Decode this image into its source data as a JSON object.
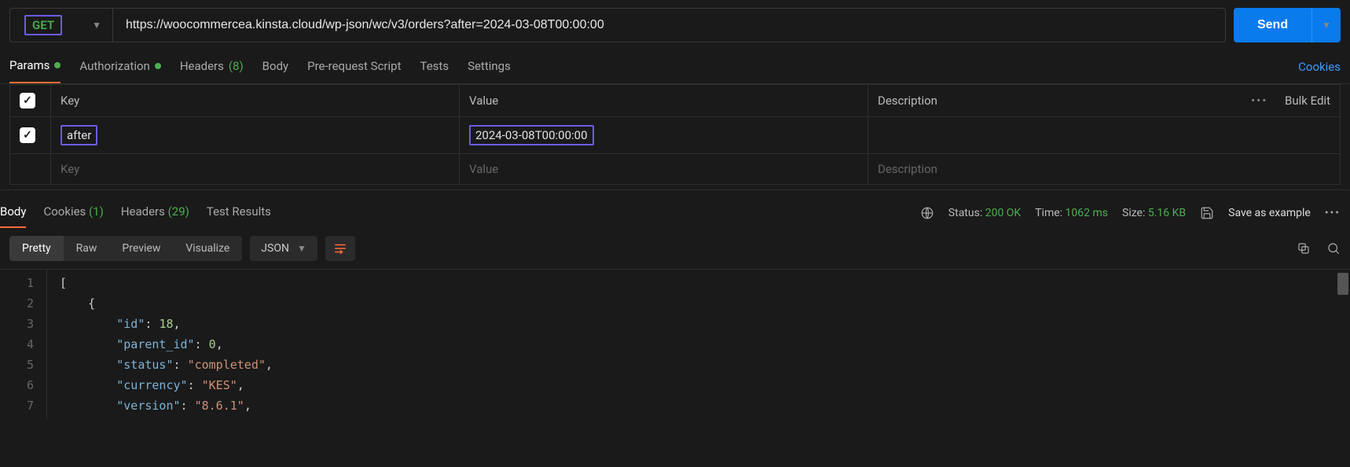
{
  "request": {
    "method": "GET",
    "url": "https://woocommercea.kinsta.cloud/wp-json/wc/v3/orders?after=2024-03-08T00:00:00",
    "send_label": "Send"
  },
  "req_tabs": {
    "params": "Params",
    "authorization": "Authorization",
    "headers": "Headers",
    "headers_count": "(8)",
    "body": "Body",
    "prerequest": "Pre-request Script",
    "tests": "Tests",
    "settings": "Settings",
    "cookies_link": "Cookies"
  },
  "params_table": {
    "header_key": "Key",
    "header_value": "Value",
    "header_description": "Description",
    "bulk_edit": "Bulk Edit",
    "rows": [
      {
        "enabled": true,
        "key": "after",
        "value": "2024-03-08T00:00:00",
        "description": ""
      }
    ],
    "placeholder_key": "Key",
    "placeholder_value": "Value",
    "placeholder_description": "Description"
  },
  "resp_tabs": {
    "body": "Body",
    "cookies": "Cookies",
    "cookies_count": "(1)",
    "headers": "Headers",
    "headers_count": "(29)",
    "test_results": "Test Results"
  },
  "resp_meta": {
    "status_label": "Status:",
    "status_value": "200 OK",
    "time_label": "Time:",
    "time_value": "1062 ms",
    "size_label": "Size:",
    "size_value": "5.16 KB",
    "save_example": "Save as example"
  },
  "body_toolbar": {
    "pretty": "Pretty",
    "raw": "Raw",
    "preview": "Preview",
    "visualize": "Visualize",
    "format": "JSON"
  },
  "code": {
    "lines": [
      "1",
      "2",
      "3",
      "4",
      "5",
      "6",
      "7"
    ],
    "json_lines": [
      {
        "indent": 0,
        "tokens": [
          {
            "t": "punc",
            "v": "["
          }
        ]
      },
      {
        "indent": 1,
        "tokens": [
          {
            "t": "punc",
            "v": "{"
          }
        ]
      },
      {
        "indent": 2,
        "tokens": [
          {
            "t": "key",
            "v": "\"id\""
          },
          {
            "t": "punc",
            "v": ": "
          },
          {
            "t": "num",
            "v": "18"
          },
          {
            "t": "punc",
            "v": ","
          }
        ]
      },
      {
        "indent": 2,
        "tokens": [
          {
            "t": "key",
            "v": "\"parent_id\""
          },
          {
            "t": "punc",
            "v": ": "
          },
          {
            "t": "num",
            "v": "0"
          },
          {
            "t": "punc",
            "v": ","
          }
        ]
      },
      {
        "indent": 2,
        "tokens": [
          {
            "t": "key",
            "v": "\"status\""
          },
          {
            "t": "punc",
            "v": ": "
          },
          {
            "t": "str",
            "v": "\"completed\""
          },
          {
            "t": "punc",
            "v": ","
          }
        ]
      },
      {
        "indent": 2,
        "tokens": [
          {
            "t": "key",
            "v": "\"currency\""
          },
          {
            "t": "punc",
            "v": ": "
          },
          {
            "t": "str",
            "v": "\"KES\""
          },
          {
            "t": "punc",
            "v": ","
          }
        ]
      },
      {
        "indent": 2,
        "tokens": [
          {
            "t": "key",
            "v": "\"version\""
          },
          {
            "t": "punc",
            "v": ": "
          },
          {
            "t": "str",
            "v": "\"8.6.1\""
          },
          {
            "t": "punc",
            "v": ","
          }
        ]
      }
    ]
  }
}
